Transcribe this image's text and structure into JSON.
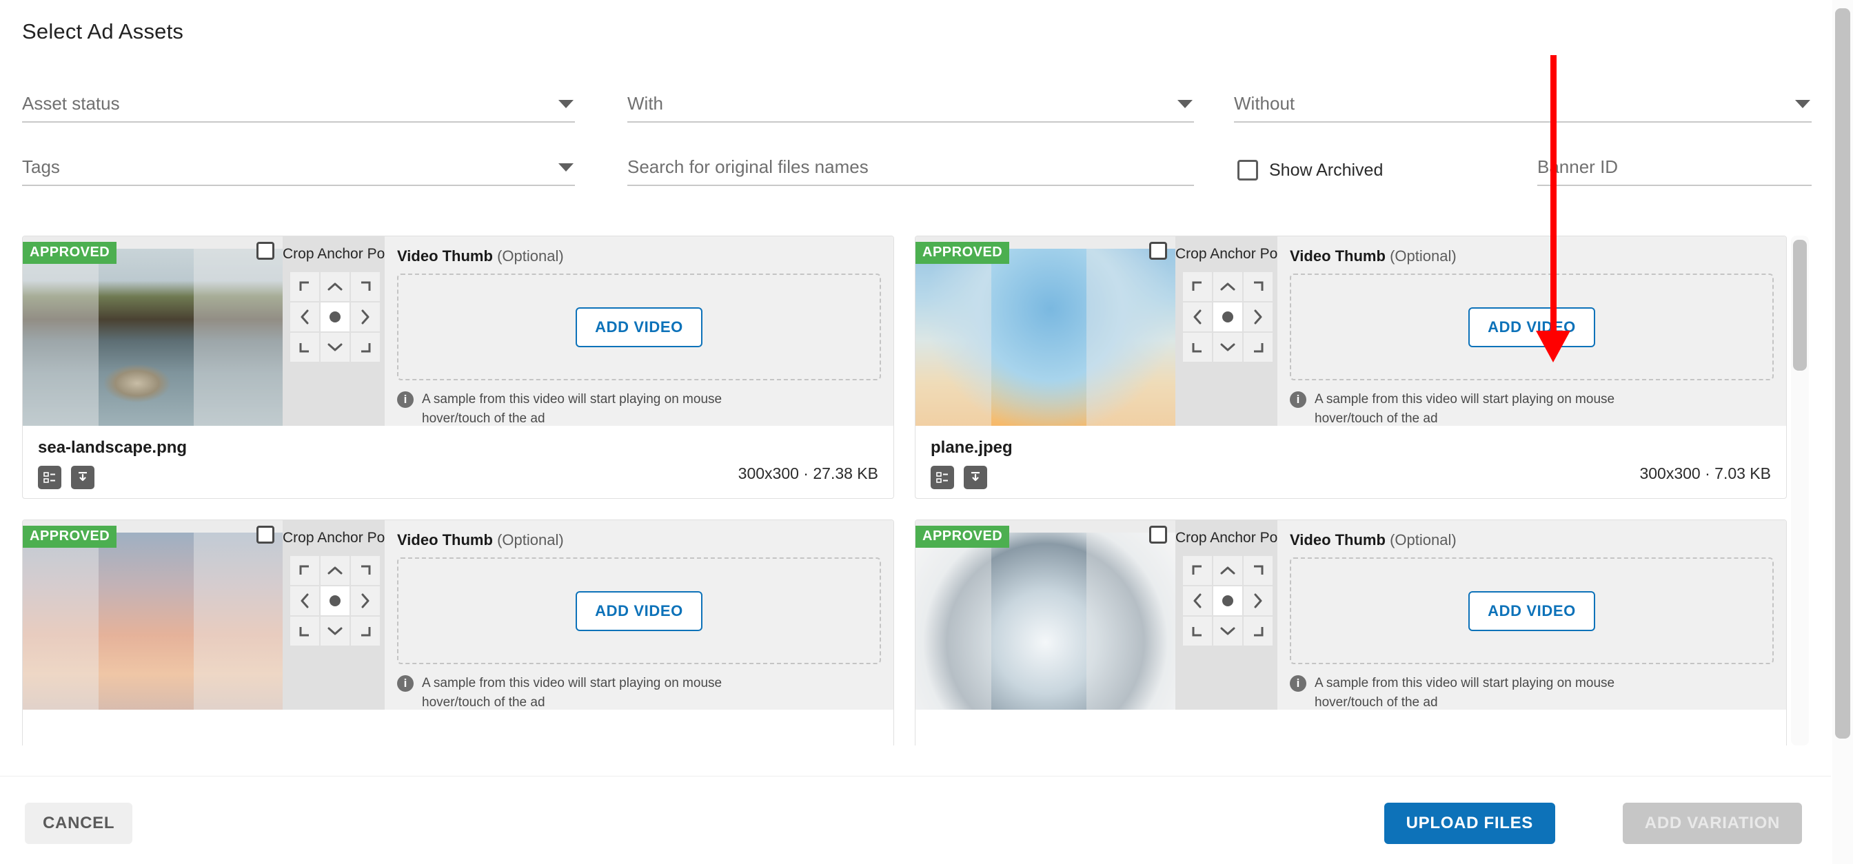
{
  "page": {
    "title": "Select Ad Assets"
  },
  "filters": {
    "asset_status": {
      "label": "Asset status",
      "icon": "chevron-down-icon"
    },
    "with": {
      "label": "With",
      "icon": "chevron-down-icon"
    },
    "without": {
      "label": "Without",
      "icon": "chevron-down-icon"
    },
    "tags": {
      "label": "Tags",
      "icon": "chevron-down-icon"
    },
    "search": {
      "placeholder": "Search for original files names",
      "value": ""
    },
    "show_archived": {
      "label": "Show Archived",
      "checked": false
    },
    "banner_id": {
      "placeholder": "Banner ID",
      "value": ""
    }
  },
  "crop_anchor": {
    "title": "Crop Anchor Point",
    "cells": [
      "top-left",
      "top-center",
      "top-right",
      "middle-left",
      "center",
      "middle-right",
      "bottom-left",
      "bottom-center",
      "bottom-right"
    ],
    "selected": "center"
  },
  "video_thumb": {
    "title": "Video Thumb",
    "optional_suffix": "(Optional)",
    "add_button": "ADD VIDEO",
    "note": "A sample from this video will start playing on mouse hover/touch of the ad",
    "info_icon": "info-icon"
  },
  "assets": [
    {
      "status_badge": "APPROVED",
      "selected": false,
      "file_name": "sea-landscape.png",
      "dimensions": "300x300",
      "file_size": "27.38 KB",
      "meta": "300x300 · 27.38 KB",
      "scene": "sc-sea",
      "actions": [
        "details-icon",
        "download-icon"
      ]
    },
    {
      "status_badge": "APPROVED",
      "selected": false,
      "file_name": "plane.jpeg",
      "dimensions": "300x300",
      "file_size": "7.03 KB",
      "meta": "300x300 · 7.03 KB",
      "scene": "sc-plane",
      "actions": [
        "details-icon",
        "download-icon"
      ]
    },
    {
      "status_badge": "APPROVED",
      "selected": false,
      "file_name": "",
      "dimensions": "",
      "file_size": "",
      "meta": "",
      "scene": "sc-sunset",
      "actions": [
        "details-icon",
        "download-icon"
      ]
    },
    {
      "status_badge": "APPROVED",
      "selected": false,
      "file_name": "",
      "dimensions": "",
      "file_size": "",
      "meta": "",
      "scene": "sc-globe",
      "actions": [
        "details-icon",
        "download-icon"
      ]
    }
  ],
  "footer": {
    "cancel": "CANCEL",
    "upload": "UPLOAD FILES",
    "add_variation": "ADD VARIATION"
  },
  "annotation": {
    "type": "red-arrow",
    "color": "#ff0000",
    "points_to": "ADD VIDEO"
  },
  "colors": {
    "primary": "#0d72b9",
    "approved": "#4caf50",
    "annotation": "#ff0000",
    "disabled": "#c6c6c6"
  }
}
